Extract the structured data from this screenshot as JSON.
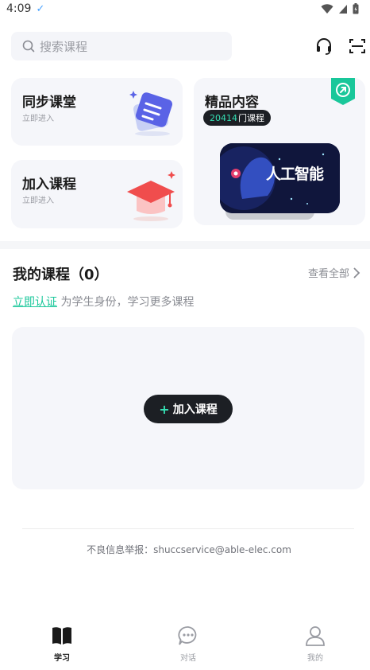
{
  "status_bar": {
    "time": "4:09"
  },
  "search": {
    "placeholder": "搜索课程"
  },
  "cards": {
    "sync": {
      "title": "同步课堂",
      "subtitle": "立即进入"
    },
    "join": {
      "title": "加入课程",
      "subtitle": "立即进入"
    },
    "premium": {
      "title": "精品内容",
      "count": "20414",
      "count_suffix": "门课程",
      "banner_text": "人工智能"
    }
  },
  "my_courses": {
    "title": "我的课程（0）",
    "view_all": "查看全部",
    "verify_link": "立即认证",
    "verify_text": " 为学生身份，学习更多课程",
    "add_button": "加入课程",
    "add_plus": "+"
  },
  "footer": {
    "report": "不良信息举报：shuccservice@able-elec.com"
  },
  "nav": [
    {
      "label": "学习",
      "icon": "book-icon",
      "active": true
    },
    {
      "label": "对话",
      "icon": "chat-icon",
      "active": false
    },
    {
      "label": "我的",
      "icon": "user-icon",
      "active": false
    }
  ],
  "colors": {
    "accent": "#19c79a",
    "dark": "#1c1f24",
    "muted": "#9a9ca3",
    "card_bg": "#f5f6fa"
  }
}
